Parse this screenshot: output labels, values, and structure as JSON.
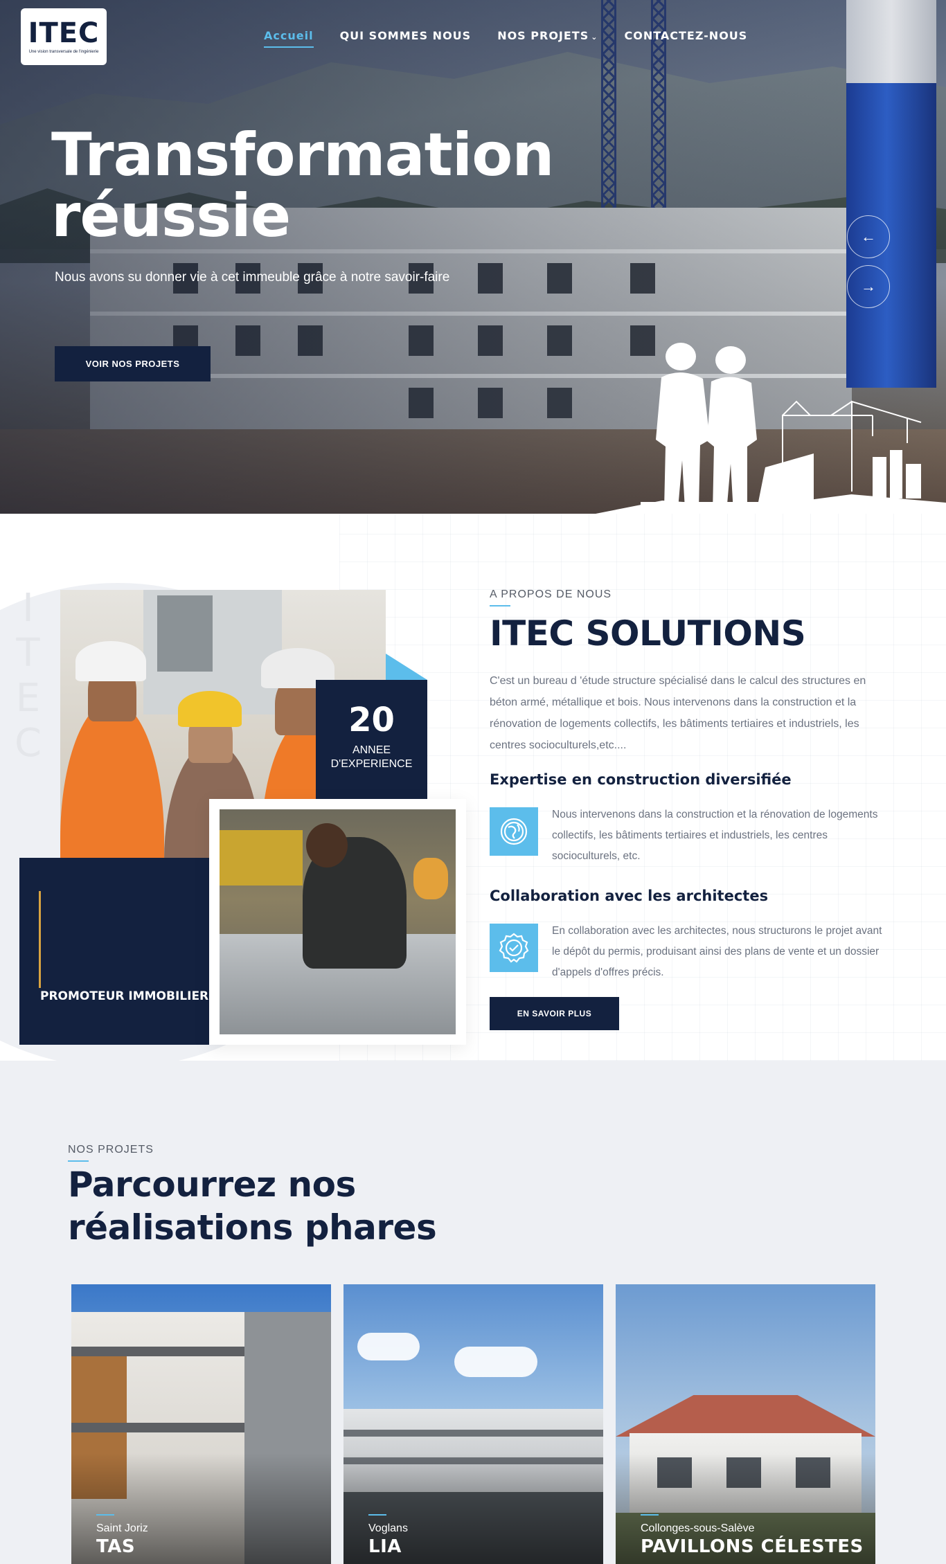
{
  "header": {
    "logo_text": "ITEC",
    "logo_tagline": "Une vision transversale de l'ingénierie",
    "nav": [
      {
        "label": "Accueil",
        "active": true
      },
      {
        "label": "QUI SOMMES NOUS",
        "active": false
      },
      {
        "label": "NOS PROJETS",
        "active": false,
        "has_dropdown": true
      },
      {
        "label": "CONTACTEZ-NOUS",
        "active": false
      }
    ]
  },
  "hero": {
    "title_line1": "Transformation",
    "title_line2": "réussie",
    "subtitle": "Nous avons su donner vie à cet immeuble grâce à notre savoir-faire",
    "cta": "VOIR NOS PROJETS",
    "prev_arrow": "←",
    "next_arrow": "→"
  },
  "about": {
    "vertical_text": "ITEC",
    "experience_number": "20",
    "experience_label_1": "ANNEE",
    "experience_label_2": "D'EXPERIENCE",
    "promo_label": "PROMOTEUR IMMOBILIER",
    "kicker": "A PROPOS DE NOUS",
    "title": "ITEC SOLUTIONS",
    "body": "C'est un bureau d 'étude structure spécialisé dans le calcul des structures en béton armé, métallique et bois. Nous intervenons dans la construction et la rénovation de logements collectifs, les bâtiments tertiaires et industriels, les centres socioculturels,etc....",
    "features": [
      {
        "heading": "Expertise en construction diversifiée",
        "icon": "globe-icon",
        "text": "Nous intervenons dans la construction et la rénovation de logements collectifs, les bâtiments tertiaires et industriels, les centres socioculturels, etc."
      },
      {
        "heading": "Collaboration avec les architectes",
        "icon": "badge-check-icon",
        "text": "En collaboration avec les architectes, nous structurons le projet avant le dépôt du permis, produisant ainsi des plans de vente et un dossier d'appels d'offres précis."
      }
    ],
    "cta": "EN SAVOIR PLUS"
  },
  "projects": {
    "kicker": "NOS PROJETS",
    "title": "Parcourrez nos réalisations phares",
    "cards": [
      {
        "location": "Saint Joriz",
        "name": "TAS"
      },
      {
        "location": "Voglans",
        "name": "LIA"
      },
      {
        "location": "Collonges-sous-Salève",
        "name": "PAVILLONS CÉLESTES"
      }
    ]
  },
  "colors": {
    "navy": "#13213f",
    "accent_blue": "#5cbdeb",
    "gold": "#d9a441"
  }
}
